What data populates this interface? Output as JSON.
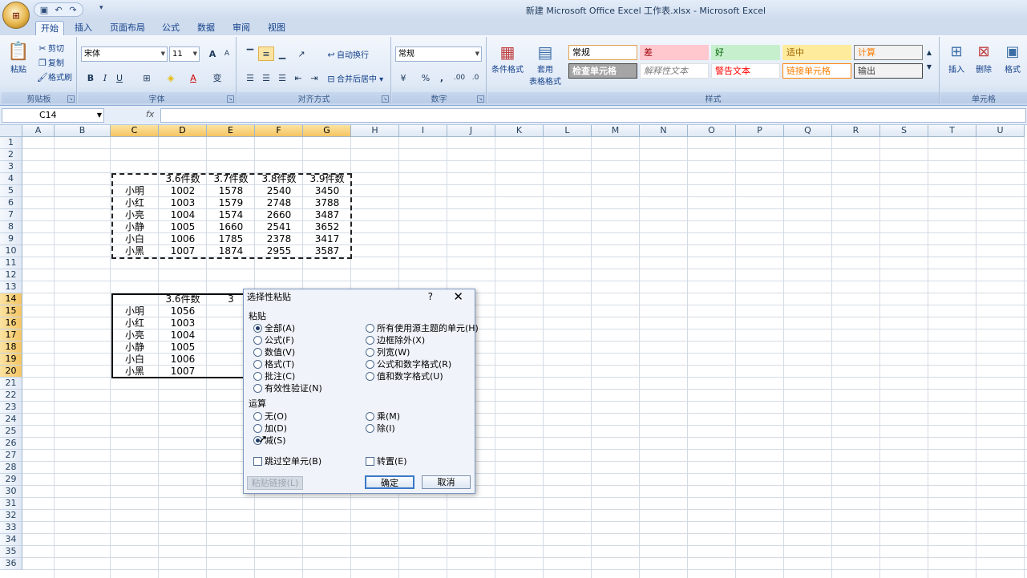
{
  "window": {
    "title": "新建 Microsoft Office Excel 工作表.xlsx - Microsoft Excel"
  },
  "qat": {
    "dropdown": "▾"
  },
  "tabs": [
    "开始",
    "插入",
    "页面布局",
    "公式",
    "数据",
    "审阅",
    "视图"
  ],
  "ribbon": {
    "clipboard": {
      "label": "剪贴板",
      "paste": "粘贴",
      "cut": "剪切",
      "copy": "复制",
      "format_painter": "格式刷"
    },
    "font": {
      "label": "字体",
      "name": "宋体",
      "size": "11",
      "grow": "A",
      "shrink": "A",
      "bold": "B",
      "italic": "I",
      "underline": "U",
      "border": "⊞",
      "fill": "◈",
      "color": "A",
      "phonetic": "变"
    },
    "alignment": {
      "label": "对齐方式",
      "wrap": "自动换行",
      "merge": "合并后居中"
    },
    "number": {
      "label": "数字",
      "format": "常规",
      "percent": "%",
      "comma": ",",
      "inc_decimal": ".00",
      "dec_decimal": ".0"
    },
    "styles": {
      "label": "样式",
      "conditional": "条件格式",
      "table1": "套用",
      "table2": "表格格式",
      "cells": [
        {
          "text": "常规",
          "bg": "#ffffff",
          "color": "#000000",
          "border": "#e0a050"
        },
        {
          "text": "差",
          "bg": "#ffc7ce",
          "color": "#9c0006",
          "border": "#ffc7ce"
        },
        {
          "text": "好",
          "bg": "#c6efce",
          "color": "#006100",
          "border": "#c6efce"
        },
        {
          "text": "适中",
          "bg": "#ffeb9c",
          "color": "#9c6500",
          "border": "#ffeb9c"
        },
        {
          "text": "计算",
          "bg": "#f2f2f2",
          "color": "#fa7d00",
          "border": "#7f7f7f"
        },
        {
          "text": "检查单元格",
          "bg": "#a5a5a5",
          "color": "#ffffff",
          "border": "#3f3f3f"
        },
        {
          "text": "解释性文本",
          "bg": "#ffffff",
          "color": "#7f7f7f",
          "border": "#e0e0e0"
        },
        {
          "text": "警告文本",
          "bg": "#ffffff",
          "color": "#ff0000",
          "border": "#e0e0e0"
        },
        {
          "text": "链接单元格",
          "bg": "#ffffff",
          "color": "#fa7d00",
          "border": "#ff8001"
        },
        {
          "text": "输出",
          "bg": "#f2f2f2",
          "color": "#3f3f3f",
          "border": "#3f3f3f"
        }
      ]
    },
    "cells": {
      "label": "单元格",
      "insert": "插入",
      "delete": "删除",
      "format": "格式"
    }
  },
  "formula_bar": {
    "name_box": "C14",
    "fx": "fx",
    "value": ""
  },
  "columns": [
    "A",
    "B",
    "C",
    "D",
    "E",
    "F",
    "G",
    "H",
    "I",
    "J",
    "K",
    "L",
    "M",
    "N",
    "O",
    "P",
    "Q",
    "R",
    "S",
    "T",
    "U"
  ],
  "rows": [
    "1",
    "2",
    "3",
    "4",
    "5",
    "6",
    "7",
    "8",
    "9",
    "10",
    "11",
    "12",
    "13",
    "14",
    "15",
    "16",
    "17",
    "18",
    "19",
    "20",
    "21",
    "22",
    "23",
    "24",
    "25",
    "26",
    "27",
    "28",
    "29",
    "30",
    "31",
    "32",
    "33",
    "34",
    "35",
    "36"
  ],
  "table1": {
    "headers": [
      "3.6件数",
      "3.7件数",
      "3.8件数",
      "3.9件数"
    ],
    "rows": [
      [
        "小明",
        "1002",
        "1578",
        "2540",
        "3450"
      ],
      [
        "小红",
        "1003",
        "1579",
        "2748",
        "3788"
      ],
      [
        "小亮",
        "1004",
        "1574",
        "2660",
        "3487"
      ],
      [
        "小静",
        "1005",
        "1660",
        "2541",
        "3652"
      ],
      [
        "小白",
        "1006",
        "1785",
        "2378",
        "3417"
      ],
      [
        "小黑",
        "1007",
        "1874",
        "2955",
        "3587"
      ]
    ]
  },
  "table2": {
    "headers": [
      "3.6件数",
      "3"
    ],
    "rows": [
      [
        "小明",
        "1056"
      ],
      [
        "小红",
        "1003"
      ],
      [
        "小亮",
        "1004"
      ],
      [
        "小静",
        "1005"
      ],
      [
        "小白",
        "1006"
      ],
      [
        "小黑",
        "1007"
      ]
    ]
  },
  "dialog": {
    "title": "选择性粘贴",
    "help": "?",
    "close": "✕",
    "paste_label": "粘贴",
    "paste_left": [
      "全部(A)",
      "公式(F)",
      "数值(V)",
      "格式(T)",
      "批注(C)",
      "有效性验证(N)"
    ],
    "paste_right": [
      "所有使用源主题的单元(H)",
      "边框除外(X)",
      "列宽(W)",
      "公式和数字格式(R)",
      "值和数字格式(U)"
    ],
    "op_label": "运算",
    "op_left": [
      "无(O)",
      "加(D)",
      "减(S)"
    ],
    "op_right": [
      "乘(M)",
      "除(I)"
    ],
    "skip_blanks": "跳过空单元(B)",
    "transpose": "转置(E)",
    "paste_link": "粘贴链接(L)",
    "ok": "确定",
    "cancel": "取消"
  }
}
